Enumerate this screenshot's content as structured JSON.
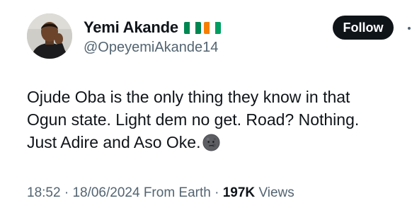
{
  "author": {
    "display_name": "Yemi Akande",
    "handle": "@OpeyemiAkande14",
    "flags": [
      {
        "name": "nigeria-flag",
        "stripes": [
          "#008751",
          "#ffffff",
          "#008751"
        ]
      },
      {
        "name": "ivory-coast-flag",
        "stripes": [
          "#f77f00",
          "#ffffff",
          "#009e60"
        ]
      }
    ],
    "avatar_icon": "person-photo"
  },
  "follow_button": {
    "label": "Follow"
  },
  "tweet": {
    "lines": [
      "Ojude Oba is the only thing they know in that",
      "Ogun state. Light dem no get. Road? Nothing.",
      "Just Adire and Aso Oke."
    ],
    "emoji": "new-moon-face-emoji"
  },
  "meta": {
    "time": "18:52",
    "separator": "·",
    "date": "18/06/2024",
    "source": "From Earth",
    "views_count": "197K",
    "views_label": "Views"
  },
  "colors": {
    "text": "#0f1419",
    "secondary": "#536471",
    "button_bg": "#0f1419"
  }
}
